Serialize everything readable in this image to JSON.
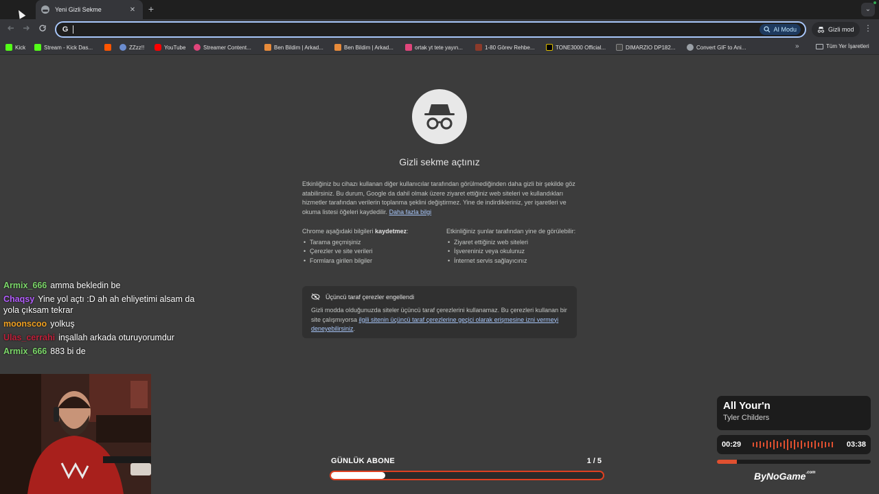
{
  "browser": {
    "tab_title": "Yeni Gizli Sekme",
    "tab_close": "✕",
    "new_tab": "+",
    "tab_menu": "⌄",
    "address_value": "",
    "ai_mode_label": "AI Modu",
    "incognito_chip": "Gizli mod",
    "menu_icon": "⋮"
  },
  "bookmarks": {
    "items": [
      {
        "label": "Kick",
        "color": "#53fc18"
      },
      {
        "label": "Stream - Kick Das...",
        "color": "#53fc18"
      },
      {
        "label": "",
        "color": "#ff5500"
      },
      {
        "label": "ZZzz!!",
        "color": "#6b8cce"
      },
      {
        "label": "YouTube",
        "color": "#ff0000"
      },
      {
        "label": "Streamer Content...",
        "color": "#e0457b"
      },
      {
        "label": "Ben Bildim | Arkad...",
        "color": "#e88b3a"
      },
      {
        "label": "Ben Bildim | Arkad...",
        "color": "#e88b3a"
      },
      {
        "label": "ortak yt tete yayın...",
        "color": "#e0457b"
      },
      {
        "label": "1-80 Görev Rehbe...",
        "color": "#8b3a2a"
      },
      {
        "label": "TONE3000 Official...",
        "color": "#000000"
      },
      {
        "label": "DIMARZIO DP182...",
        "color": "#444444"
      },
      {
        "label": "Convert GIF to Ani...",
        "color": "#9aa0a6"
      }
    ],
    "more": "»",
    "all_bookmarks": "Tüm Yer İşaretleri"
  },
  "incognito": {
    "title": "Gizli sekme açtınız",
    "intro": "Etkinliğiniz bu cihazı kullanan diğer kullanıcılar tarafından görülmediğinden daha gizli bir şekilde göz atabilirsiniz. Bu durum, Google da dahil olmak üzere ziyaret ettiğiniz web siteleri ve kullandıkları hizmetler tarafından verilerin toplanma şeklini değiştirmez. Yine de indirdikleriniz, yer işaretleri ve okuma listesi öğeleri kaydedilir.",
    "learn_more": "Daha fazla bilgi",
    "left_heading_pre": "Chrome aşağıdaki bilgileri ",
    "left_heading_bold": "kaydetmez",
    "left_heading_post": ":",
    "left_items": [
      "Tarama geçmişiniz",
      "Çerezler ve site verileri",
      "Formlara girilen bilgiler"
    ],
    "right_heading": "Etkinliğiniz şunlar tarafından yine de görülebilir:",
    "right_items": [
      "Ziyaret ettiğiniz web siteleri",
      "İşvereniniz veya okulunuz",
      "İnternet servis sağlayıcınız"
    ],
    "cookie_title": "Üçüncü taraf çerezler engellendi",
    "cookie_text": "Gizli modda olduğunuzda siteler üçüncü taraf çerezlerini kullanamaz. Bu çerezleri kullanan bir site çalışmıyorsa ",
    "cookie_link": "ilgili sitenin üçüncü taraf çerezlerine geçici olarak erişmesine izni vermeyi deneyebilirsiniz",
    "cookie_end": "."
  },
  "chat": [
    {
      "user": "Armix_666",
      "color": "#7cd86a",
      "text": "amma bekledin be"
    },
    {
      "user": "Chaqsy",
      "color": "#b45cff",
      "text": "Yine yol açtı :D ah ah ehliyetimi alsam da yola çıksam tekrar"
    },
    {
      "user": "moonscoo",
      "color": "#f0a020",
      "text": "yolkuş"
    },
    {
      "user": "Ulas_cerrahi",
      "color": "#c0203a",
      "text": "inşallah arkada oturuyorumdur"
    },
    {
      "user": "Armix_666",
      "color": "#7cd86a",
      "text": "883 bi de"
    }
  ],
  "sub_goal": {
    "title": "GÜNLÜK ABONE",
    "count": "1 / 5",
    "progress": 0.2
  },
  "now_playing": {
    "song": "All Your'n",
    "artist": "Tyler Childers",
    "elapsed": "00:29",
    "duration": "03:38",
    "progress": 0.13
  },
  "logo": {
    "text": "ByNoGame",
    "sup": ".com"
  },
  "colors": {
    "accent": "#e04020",
    "page_bg": "#3c3c3c",
    "link": "#a8c7fa"
  }
}
